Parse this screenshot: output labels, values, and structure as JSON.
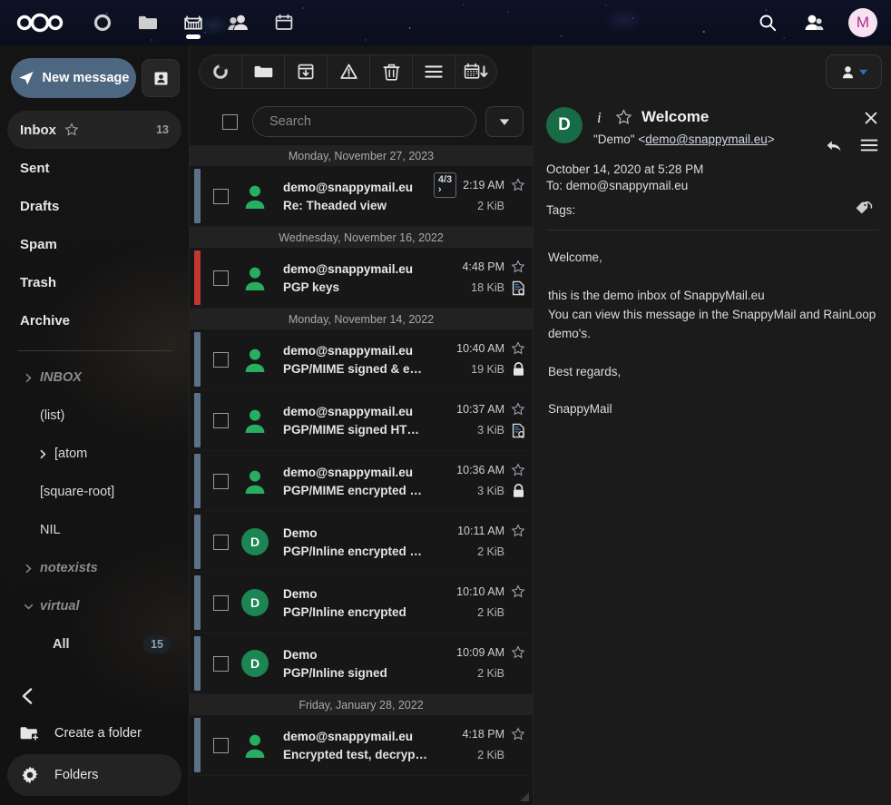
{
  "header": {
    "logo": "nextcloud-logo",
    "apps": [
      {
        "name": "dashboard",
        "icon": "circle-icon",
        "active": false
      },
      {
        "name": "files",
        "icon": "folder-icon",
        "active": false
      },
      {
        "name": "mail",
        "icon": "mail-tray-icon",
        "active": true
      },
      {
        "name": "contacts",
        "icon": "contacts-icon",
        "active": false
      },
      {
        "name": "calendar",
        "icon": "calendar-icon",
        "active": false
      }
    ],
    "search_icon": "search-icon",
    "contacts_icon": "contacts-menu-icon",
    "avatar_letter": "M",
    "avatar_bg": "#f7e3ef",
    "avatar_color": "#b0298f"
  },
  "sidebar": {
    "new_message_label": "New message",
    "contacts_button_icon": "address-book-icon",
    "folders": [
      {
        "label": "Inbox",
        "count": "13",
        "selected": true,
        "star": true
      },
      {
        "label": "Sent",
        "count": "",
        "selected": false,
        "star": false
      },
      {
        "label": "Drafts",
        "count": "",
        "selected": false,
        "star": false
      },
      {
        "label": "Spam",
        "count": "",
        "selected": false,
        "star": false
      },
      {
        "label": "Trash",
        "count": "",
        "selected": false,
        "star": false
      },
      {
        "label": "Archive",
        "count": "",
        "selected": false,
        "star": false
      }
    ],
    "subfolders": [
      {
        "label": "INBOX",
        "caret": "right",
        "dim": true,
        "indent": false,
        "count": "",
        "bold": false
      },
      {
        "label": "(list)",
        "caret": "none",
        "dim": false,
        "indent": true,
        "count": "",
        "bold": false
      },
      {
        "label": "[atom",
        "caret": "right",
        "dim": false,
        "indent": false,
        "count": "",
        "bold": false
      },
      {
        "label": "[square-root]",
        "caret": "none",
        "dim": false,
        "indent": true,
        "count": "",
        "bold": false
      },
      {
        "label": "NIL",
        "caret": "none",
        "dim": false,
        "indent": true,
        "count": "",
        "bold": false
      },
      {
        "label": "notexists",
        "caret": "right",
        "dim": true,
        "indent": false,
        "count": "",
        "bold": false
      },
      {
        "label": "virtual",
        "caret": "down",
        "dim": true,
        "indent": false,
        "count": "",
        "bold": false
      },
      {
        "label": "All",
        "caret": "none",
        "dim": false,
        "indent": true,
        "count": "15",
        "bold": true
      }
    ],
    "collapse_icon": "chevron-left-icon",
    "create_folder_label": "Create a folder",
    "folders_label": "Folders"
  },
  "list_toolbar": {
    "buttons": [
      {
        "name": "refresh-button",
        "icon": "refresh-circle-icon"
      },
      {
        "name": "move-button",
        "icon": "folder-icon"
      },
      {
        "name": "archive-button",
        "icon": "archive-box-icon"
      },
      {
        "name": "spam-button",
        "icon": "warning-triangle-icon"
      },
      {
        "name": "delete-button",
        "icon": "trash-icon"
      },
      {
        "name": "more-button",
        "icon": "hamburger-icon"
      },
      {
        "name": "sort-button",
        "icon": "calendar-down-icon"
      }
    ]
  },
  "search": {
    "placeholder": "Search",
    "value": "",
    "filter_icon": "chevron-down-icon"
  },
  "message_list": [
    {
      "type": "date",
      "label": "Monday, November 27, 2023"
    },
    {
      "type": "message",
      "strip_color": "#5b7187",
      "avatar_type": "person",
      "avatar_letter": "",
      "from": "demo@snappymail.eu",
      "subject": "Re: Theaded view",
      "thread_badge": "4/3 ›",
      "time": "2:19 AM",
      "size": "2 KiB",
      "star": true,
      "status_icon": ""
    },
    {
      "type": "date",
      "label": "Wednesday, November 16, 2022"
    },
    {
      "type": "message",
      "strip_color": "#c0392f",
      "avatar_type": "person",
      "avatar_letter": "",
      "from": "demo@snappymail.eu",
      "subject": "PGP keys",
      "thread_badge": "",
      "time": "4:48 PM",
      "size": "18 KiB",
      "star": true,
      "status_icon": "signed-document-icon"
    },
    {
      "type": "date",
      "label": "Monday, November 14, 2022"
    },
    {
      "type": "message",
      "strip_color": "#5b7187",
      "avatar_type": "person",
      "avatar_letter": "",
      "from": "demo@snappymail.eu",
      "subject": "PGP/MIME signed & encrypted …",
      "thread_badge": "",
      "time": "10:40 AM",
      "size": "19 KiB",
      "star": true,
      "status_icon": "lock-icon"
    },
    {
      "type": "message",
      "strip_color": "#5b7187",
      "avatar_type": "person",
      "avatar_letter": "",
      "from": "demo@snappymail.eu",
      "subject": "PGP/MIME signed HTML messa…",
      "thread_badge": "",
      "time": "10:37 AM",
      "size": "3 KiB",
      "star": true,
      "status_icon": "signed-document-icon"
    },
    {
      "type": "message",
      "strip_color": "#5b7187",
      "avatar_type": "person",
      "avatar_letter": "",
      "from": "demo@snappymail.eu",
      "subject": "PGP/MIME encrypted HTML me…",
      "thread_badge": "",
      "time": "10:36 AM",
      "size": "3 KiB",
      "star": true,
      "status_icon": "lock-icon"
    },
    {
      "type": "message",
      "strip_color": "#5b7187",
      "avatar_type": "letter",
      "avatar_letter": "D",
      "from": "Demo",
      "subject": "PGP/Inline encrypted & signed",
      "thread_badge": "",
      "time": "10:11 AM",
      "size": "2 KiB",
      "star": true,
      "status_icon": ""
    },
    {
      "type": "message",
      "strip_color": "#5b7187",
      "avatar_type": "letter",
      "avatar_letter": "D",
      "from": "Demo",
      "subject": "PGP/Inline encrypted",
      "thread_badge": "",
      "time": "10:10 AM",
      "size": "2 KiB",
      "star": true,
      "status_icon": ""
    },
    {
      "type": "message",
      "strip_color": "#5b7187",
      "avatar_type": "letter",
      "avatar_letter": "D",
      "from": "Demo",
      "subject": "PGP/Inline signed",
      "thread_badge": "",
      "time": "10:09 AM",
      "size": "2 KiB",
      "star": true,
      "status_icon": ""
    },
    {
      "type": "date",
      "label": "Friday, January 28, 2022"
    },
    {
      "type": "message",
      "strip_color": "#5b7187",
      "avatar_type": "person",
      "avatar_letter": "",
      "from": "demo@snappymail.eu",
      "subject": "Encrypted test, decrypt pass: demo",
      "thread_badge": "",
      "time": "4:18 PM",
      "size": "2 KiB",
      "star": true,
      "status_icon": ""
    }
  ],
  "message_view": {
    "identity_button_icon": "person-dropdown-icon",
    "avatar_letter": "D",
    "avatar_bg": "#176b45",
    "info_icon": "info-icon",
    "star_icon": "star-icon",
    "subject": "Welcome",
    "from_prefix": "\"Demo\" <",
    "from_email": "demo@snappymail.eu",
    "from_suffix": ">",
    "close_icon": "close-icon",
    "reply_icon": "reply-icon",
    "menu_icon": "hamburger-icon",
    "date": "October 14, 2020 at 5:28 PM",
    "to": "To: demo@snappymail.eu",
    "tags_label": "Tags:",
    "tag_icon": "tag-icon",
    "body": "Welcome,\n\nthis is the demo inbox of SnappyMail.eu\nYou can view this message in the SnappyMail and RainLoop demo's.\n\nBest regards,\n\nSnappyMail"
  }
}
